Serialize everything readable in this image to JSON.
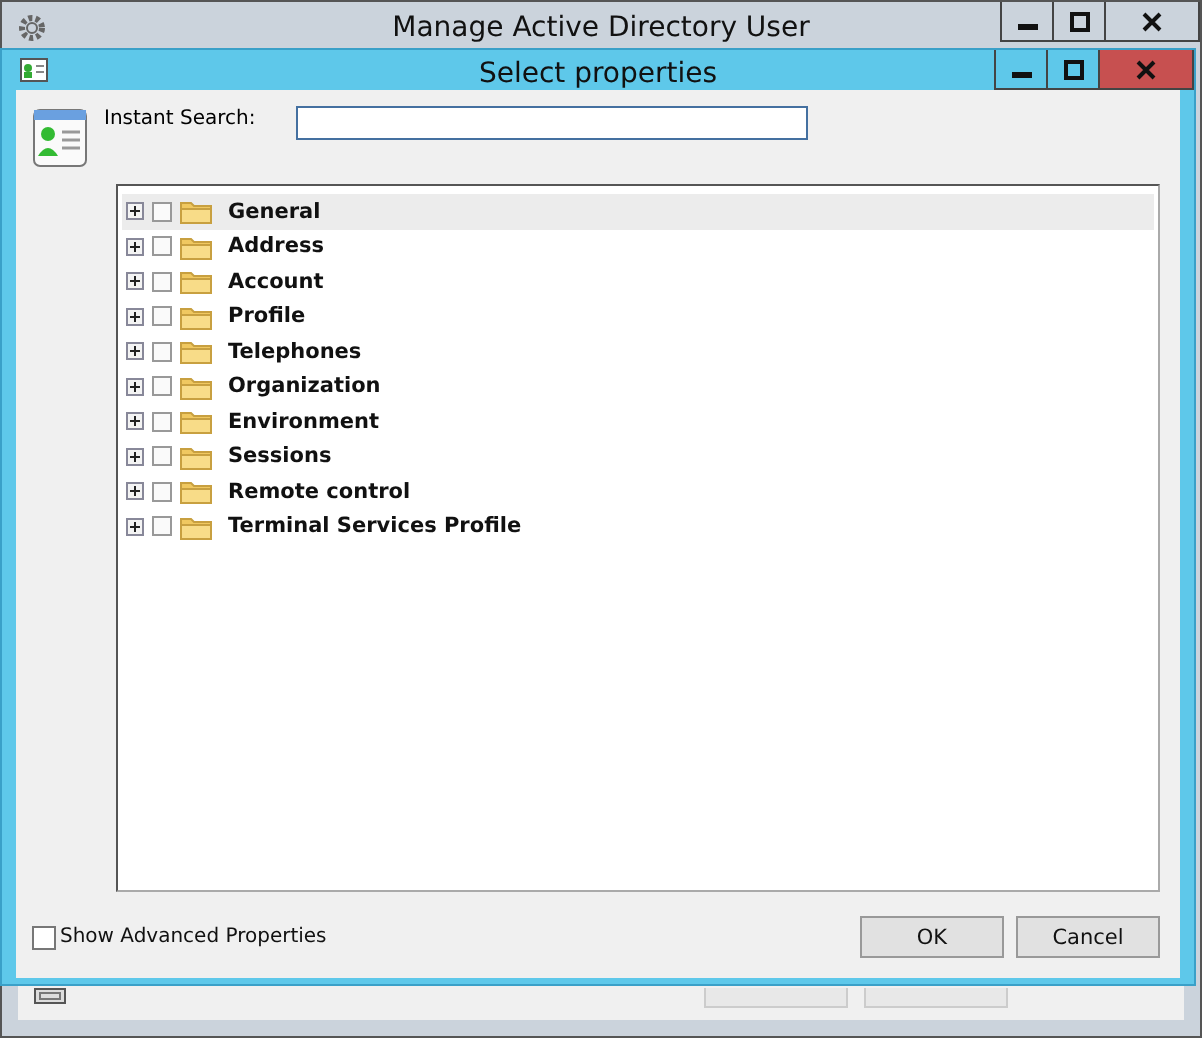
{
  "outer_window": {
    "title": "Manage Active Directory User"
  },
  "dialog": {
    "title": "Select properties",
    "search": {
      "label": "Instant Search:"
    },
    "tree": [
      {
        "label": "General",
        "checked": false,
        "selected": true
      },
      {
        "label": "Address",
        "checked": false,
        "selected": false
      },
      {
        "label": "Account",
        "checked": false,
        "selected": false
      },
      {
        "label": "Profile",
        "checked": false,
        "selected": false
      },
      {
        "label": "Telephones",
        "checked": false,
        "selected": false
      },
      {
        "label": "Organization",
        "checked": false,
        "selected": false
      },
      {
        "label": "Environment",
        "checked": false,
        "selected": false
      },
      {
        "label": "Sessions",
        "checked": false,
        "selected": false
      },
      {
        "label": "Remote control",
        "checked": false,
        "selected": false
      },
      {
        "label": "Terminal Services Profile",
        "checked": false,
        "selected": false
      }
    ],
    "advanced": {
      "label": "Show Advanced Properties",
      "checked": false
    },
    "buttons": [
      "OK",
      "Cancel"
    ]
  }
}
